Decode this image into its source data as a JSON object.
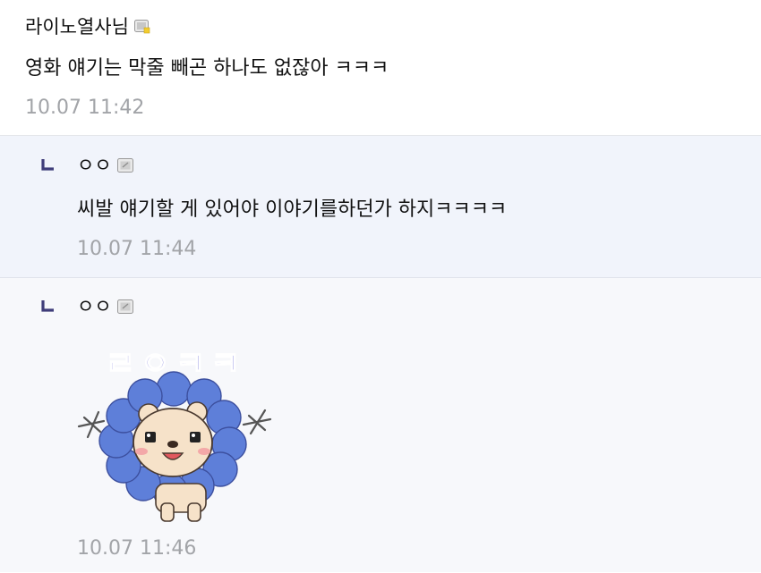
{
  "comments": [
    {
      "author": "라이노열사님",
      "text": "영화 얘기는 막줄 빼곤 하나도 없잖아 ㅋㅋㅋ",
      "time": "10.07 11:42"
    }
  ],
  "replies": [
    {
      "author": "ㅇㅇ",
      "text": "씨발 얘기할 게 있어야 이야기를하던가 하지ㅋㅋㅋㅋ",
      "time": "10.07 11:44"
    },
    {
      "author": "ㅇㅇ",
      "sticker": {
        "caption": "ㄹㅇㅋㅋ",
        "icon": "lion-sticker"
      },
      "time": "10.07 11:46"
    }
  ],
  "colors": {
    "reply_bg": "#f1f4fb",
    "reply_mark": "#3f3d7a",
    "timestamp": "#a2a4a8",
    "sticker_text": "#6f6fd8",
    "petals": "#5e7fd9"
  }
}
